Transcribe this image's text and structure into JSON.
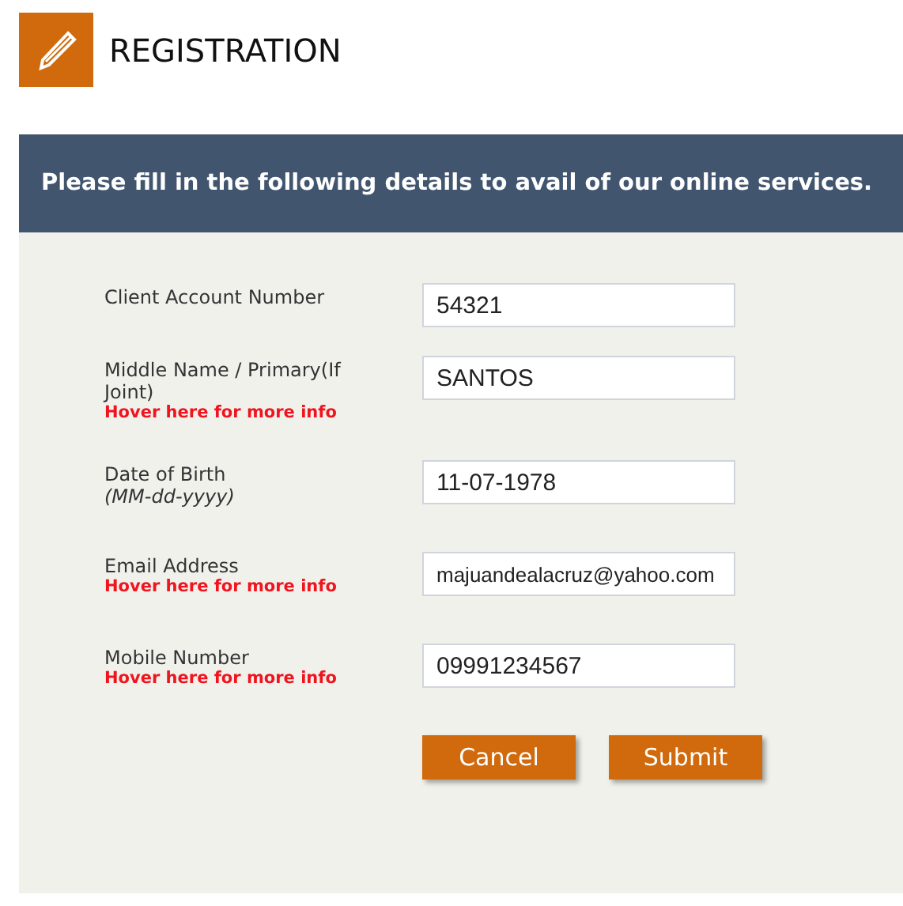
{
  "header": {
    "title": "REGISTRATION"
  },
  "banner": "Please fill in the following details to avail of our online services.",
  "fields": [
    {
      "label": "Client Account Number",
      "value": "54321"
    },
    {
      "label": "Middle Name / Primary(If Joint)",
      "info": "Hover here for more info",
      "value": "SANTOS"
    },
    {
      "label": "Date of Birth",
      "hint": "(MM-dd-yyyy)",
      "value": "11-07-1978"
    },
    {
      "label": "Email Address",
      "info": "Hover here for more info",
      "value": "majuandealacruz@yahoo.com"
    },
    {
      "label": "Mobile Number",
      "info": "Hover here for more info",
      "value": "09991234567"
    }
  ],
  "buttons": [
    "Cancel",
    "Submit"
  ]
}
